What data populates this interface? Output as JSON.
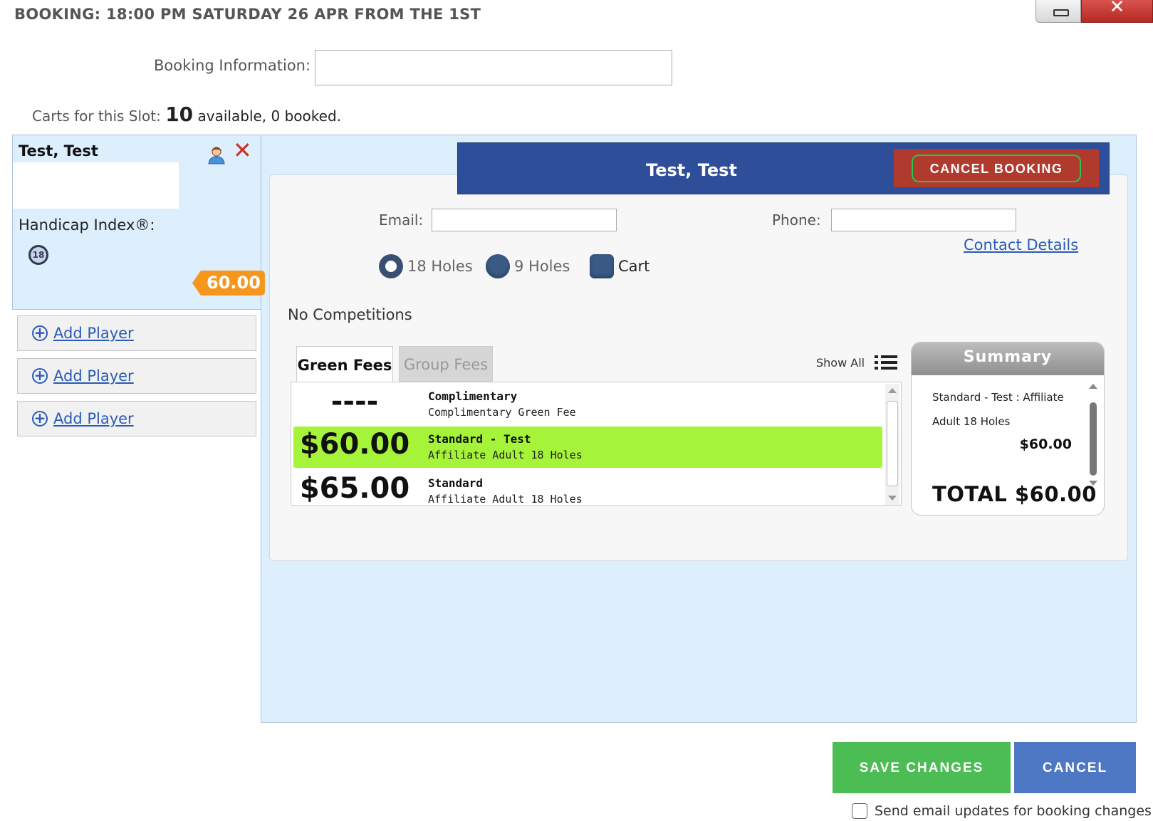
{
  "header": {
    "title": "BOOKING: 18:00 PM SATURDAY 26 APR FROM THE 1ST",
    "minimize_icon": "minimize-icon",
    "close_glyph": "✕"
  },
  "booking_info": {
    "label": "Booking Information:",
    "value": ""
  },
  "carts": {
    "label": "Carts for this Slot:",
    "available_count": "10",
    "available_text": "available, 0 booked."
  },
  "player": {
    "name": "Test, Test",
    "handicap_label": "Handicap Index®:",
    "handicap_badge": "18",
    "price_tag": "60.00",
    "remove_glyph": "✕"
  },
  "add_players": [
    {
      "label": "Add Player"
    },
    {
      "label": "Add Player"
    },
    {
      "label": "Add Player"
    }
  ],
  "details": {
    "banner_name": "Test, Test",
    "cancel_booking_label": "CANCEL BOOKING",
    "email_label": "Email:",
    "email_value": "",
    "phone_label": "Phone:",
    "phone_value": "",
    "contact_link": "Contact Details",
    "options": {
      "holes_18": {
        "label": "18 Holes",
        "selected": true
      },
      "holes_9": {
        "label": "9 Holes",
        "selected": false
      },
      "cart": {
        "label": "Cart",
        "checked": false
      }
    },
    "competitions_text": "No Competitions"
  },
  "fees": {
    "tabs": [
      {
        "label": "Green Fees",
        "active": true
      },
      {
        "label": "Group Fees",
        "active": false
      }
    ],
    "show_all_label": "Show All",
    "rows": [
      {
        "price": "----",
        "title": "Complimentary",
        "subtitle": "Complimentary Green Fee",
        "selected": false
      },
      {
        "price": "$60.00",
        "title": "Standard - Test",
        "subtitle": "Affiliate Adult 18 Holes",
        "selected": true
      },
      {
        "price": "$65.00",
        "title": "Standard",
        "subtitle": "Affiliate Adult 18 Holes",
        "selected": false
      }
    ]
  },
  "summary": {
    "heading": "Summary",
    "line1": "Standard - Test : Affiliate",
    "line2": "Adult 18 Holes",
    "amount": "$60.00",
    "total": "TOTAL $60.00"
  },
  "footer": {
    "save_label": "SAVE CHANGES",
    "cancel_label": "CANCEL",
    "email_updates_label": "Send email updates for booking changes",
    "email_updates_checked": false
  },
  "colors": {
    "banner": "#2f4e99",
    "cancel_booking_bg": "#b03a2e",
    "selected_fee": "#a6f43a",
    "save": "#4cbc54",
    "cancel": "#4f78c4",
    "price_tag": "#f7961d",
    "panel_bg": "#ddeefd"
  }
}
